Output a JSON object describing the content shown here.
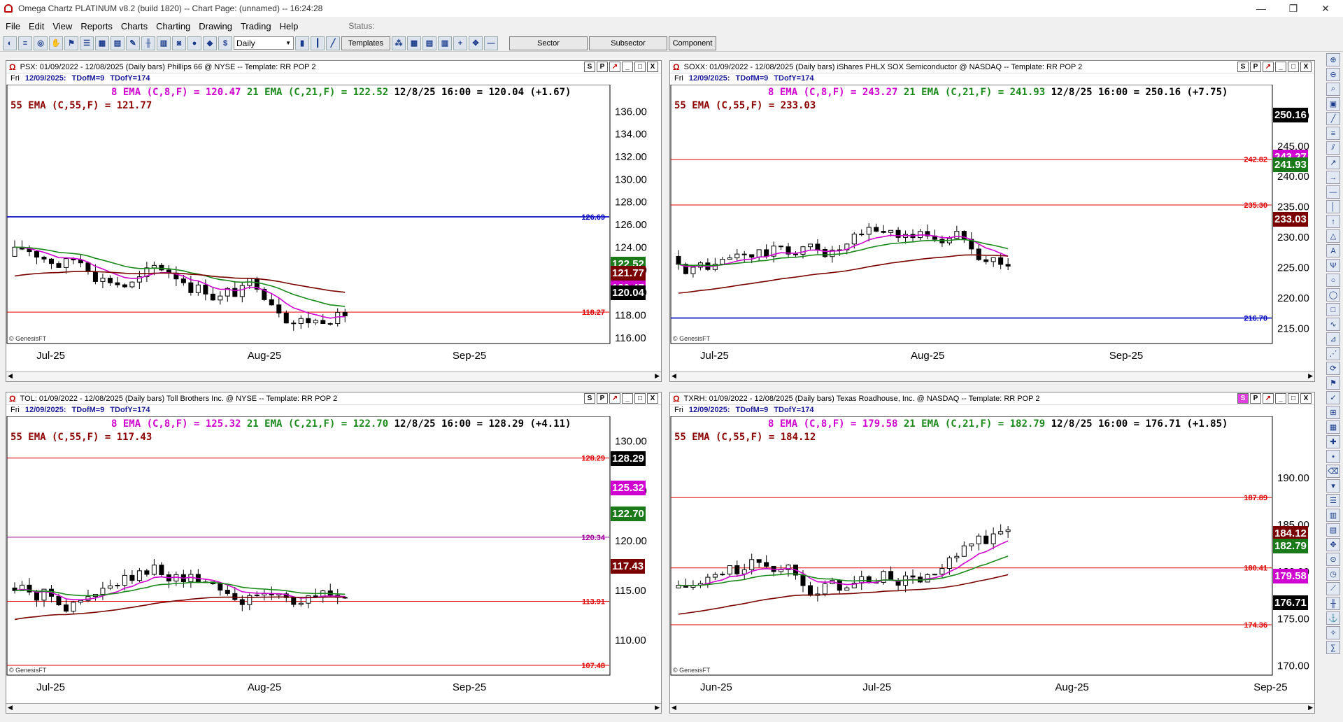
{
  "window": {
    "title": "Omega Chartz PLATINUM v8.2 (build 1820)  --  Chart Page: (unnamed)  --  16:24:28"
  },
  "menu": [
    "File",
    "Edit",
    "View",
    "Reports",
    "Charts",
    "Charting",
    "Drawing",
    "Trading",
    "Help"
  ],
  "status_label": "Status:",
  "toolbar": {
    "interval": "Daily",
    "templates": "Templates",
    "sector": "Sector",
    "subsector": "Subsector",
    "component": "Component"
  },
  "header_buttons": [
    "S",
    "P",
    "↗",
    "_",
    "□",
    "X"
  ],
  "panels": [
    {
      "id": "psx",
      "title": "PSX: 01/09/2022 - 12/08/2025  (Daily bars)   Phillips 66 @ NYSE  --  Template: RR POP 2",
      "day": "Fri",
      "date": "12/09/2025:",
      "tdofm": "TDofM=9",
      "tdofy": "TDofY=174",
      "legend1": {
        "ema8": "8 EMA (C,8,F) = 120.47",
        "ema21": "21 EMA (C,21,F) = 122.52",
        "last": "12/8/25 16:00 = 120.04 (+1.67)"
      },
      "legend2": "55 EMA (C,55,F) = 121.77",
      "xlabels": [
        "Jul-25",
        "Aug-25",
        "Sep-25"
      ],
      "yticks": [
        "136.00",
        "134.00",
        "132.00",
        "130.00",
        "128.00",
        "126.00",
        "124.00",
        "122.00",
        "120.00",
        "118.00",
        "116.00"
      ],
      "hlines": [
        {
          "value": "126.69",
          "color": "#0000c0"
        },
        {
          "value": "118.27",
          "color": "#e00000"
        }
      ],
      "tags": [
        {
          "text": "122.52",
          "bg": "#1a7a1a"
        },
        {
          "text": "121.77",
          "bg": "#7a0000"
        },
        {
          "text": "120.47",
          "bg": "#d000d0"
        },
        {
          "text": "120.04",
          "bg": "#000000"
        }
      ],
      "credit": "© GenesisFT"
    },
    {
      "id": "soxx",
      "title": "SOXX: 01/09/2022 - 12/08/2025  (Daily bars)   iShares PHLX SOX Semiconductor @ NASDAQ  --  Template: RR POP 2",
      "day": "Fri",
      "date": "12/09/2025:",
      "tdofm": "TDofM=9",
      "tdofy": "TDofY=174",
      "legend1": {
        "ema8": "8 EMA (C,8,F) = 243.27",
        "ema21": "21 EMA (C,21,F) = 241.93",
        "last": "12/8/25 16:00 = 250.16 (+7.75)"
      },
      "legend2": "55 EMA (C,55,F) = 233.03",
      "xlabels": [
        "Jul-25",
        "Aug-25",
        "Sep-25"
      ],
      "yticks": [
        "250.00",
        "245.00",
        "240.00",
        "235.00",
        "230.00",
        "225.00",
        "220.00",
        "215.00"
      ],
      "hlines": [
        {
          "value": "242.82",
          "color": "#e00000"
        },
        {
          "value": "235.30",
          "color": "#e00000"
        },
        {
          "value": "216.70",
          "color": "#0000c0"
        }
      ],
      "tags": [
        {
          "text": "250.16",
          "bg": "#000000"
        },
        {
          "text": "243.27",
          "bg": "#d000d0"
        },
        {
          "text": "241.93",
          "bg": "#1a7a1a"
        },
        {
          "text": "233.03",
          "bg": "#7a0000"
        }
      ],
      "credit": "© GenesisFT"
    },
    {
      "id": "tol",
      "title": "TOL: 01/09/2022 - 12/08/2025  (Daily bars)   Toll Brothers Inc. @ NYSE  --  Template: RR POP 2",
      "day": "Fri",
      "date": "12/09/2025:",
      "tdofm": "TDofM=9",
      "tdofy": "TDofY=174",
      "legend1": {
        "ema8": "8 EMA (C,8,F) = 125.32",
        "ema21": "21 EMA (C,21,F) = 122.70",
        "last": "12/8/25 16:00 = 128.29 (+4.11)"
      },
      "legend2": "55 EMA (C,55,F) = 117.43",
      "xlabels": [
        "Jul-25",
        "Aug-25",
        "Sep-25"
      ],
      "yticks": [
        "130.00",
        "125.00",
        "120.00",
        "115.00",
        "110.00"
      ],
      "hlines": [
        {
          "value": "128.29",
          "color": "#e00000"
        },
        {
          "value": "120.34",
          "color": "#a000a0"
        },
        {
          "value": "113.91",
          "color": "#e00000"
        },
        {
          "value": "107.48",
          "color": "#e00000"
        }
      ],
      "tags": [
        {
          "text": "128.29",
          "bg": "#000000"
        },
        {
          "text": "125.32",
          "bg": "#d000d0"
        },
        {
          "text": "122.70",
          "bg": "#1a7a1a"
        },
        {
          "text": "117.43",
          "bg": "#7a0000"
        }
      ],
      "credit": "© GenesisFT"
    },
    {
      "id": "txrh",
      "title": "TXRH: 01/09/2022 - 12/08/2025  (Daily bars)   Texas Roadhouse, Inc. @ NASDAQ  --  Template: RR POP 2",
      "day": "Fri",
      "date": "12/09/2025:",
      "tdofm": "TDofM=9",
      "tdofy": "TDofY=174",
      "legend1": {
        "ema8": "8 EMA (C,8,F) = 179.58",
        "ema21": "21 EMA (C,21,F) = 182.79",
        "last": "12/8/25 16:00 = 176.71 (+1.85)"
      },
      "legend2": "55 EMA (C,55,F) = 184.12",
      "xlabels": [
        "Jun-25",
        "Jul-25",
        "Aug-25",
        "Sep-25"
      ],
      "yticks": [
        "190.00",
        "185.00",
        "180.00",
        "175.00",
        "170.00"
      ],
      "hlines": [
        {
          "value": "187.89",
          "color": "#e00000"
        },
        {
          "value": "180.41",
          "color": "#e00000"
        },
        {
          "value": "174.36",
          "color": "#e00000"
        }
      ],
      "tags": [
        {
          "text": "184.12",
          "bg": "#7a0000"
        },
        {
          "text": "182.79",
          "bg": "#1a7a1a"
        },
        {
          "text": "179.58",
          "bg": "#d000d0"
        },
        {
          "text": "176.71",
          "bg": "#000000"
        }
      ],
      "credit": "© GenesisFT"
    }
  ]
}
